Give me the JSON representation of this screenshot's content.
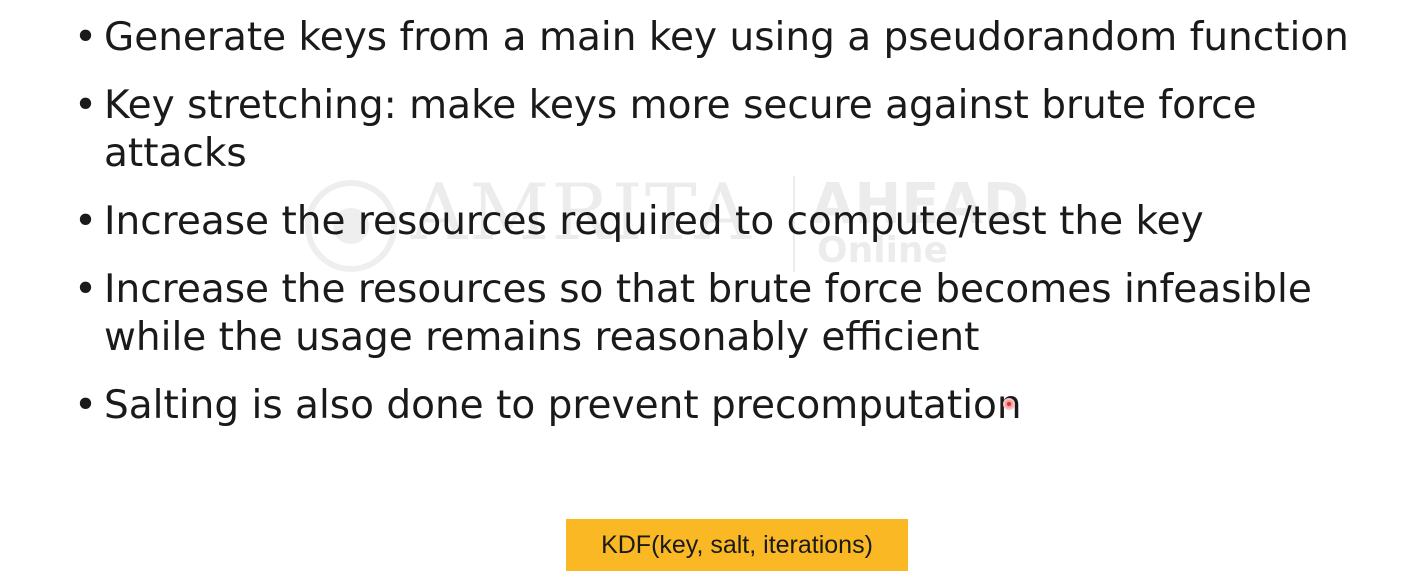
{
  "watermark": {
    "brand": "AMRITA",
    "right_top": "AHEAD",
    "right_bottom": "Online"
  },
  "bullets": [
    {
      "text": "Generate keys from a main key using a pseudorandom function"
    },
    {
      "text": "Key stretching: make keys more secure against brute force attacks"
    },
    {
      "text": "Increase the resources required to compute/test the key"
    },
    {
      "text": "Increase the resources so that brute force becomes infeasible while the usage remains reasonably efficient"
    },
    {
      "text": "Salting is also done to prevent precomputation"
    }
  ],
  "bullet_symbol": "•",
  "kdf_label": "KDF(key, salt, iterations)",
  "colors": {
    "kdf_background": "#f9b824",
    "text": "#1a1a1a",
    "cursor": "#e03030"
  }
}
